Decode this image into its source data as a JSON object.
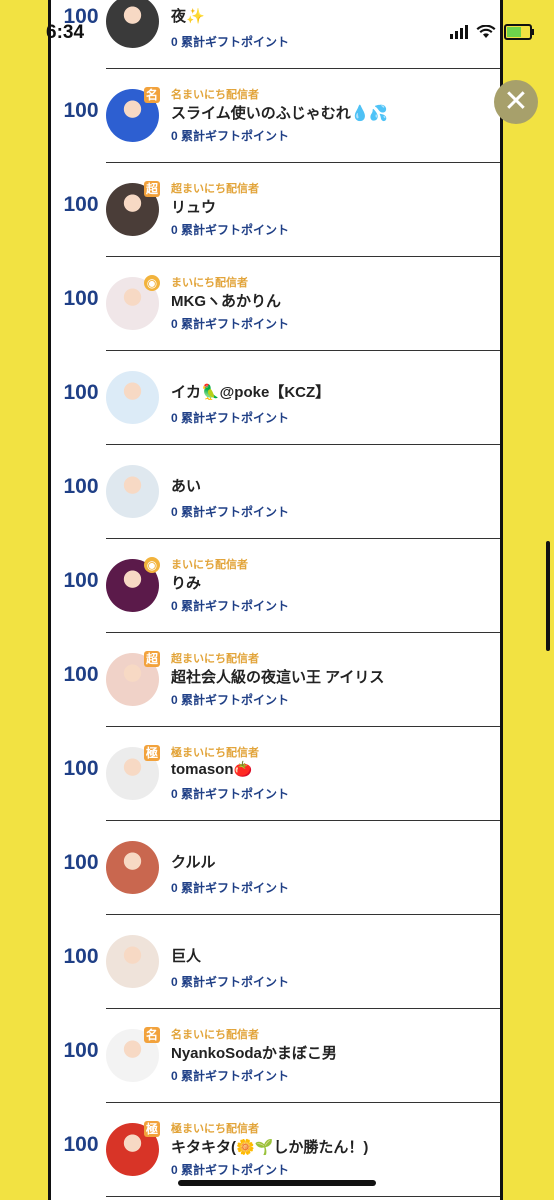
{
  "status_bar": {
    "time": "6:34"
  },
  "rows": [
    {
      "rank": "100",
      "tier": "",
      "tier_color": "#000000",
      "badge": "",
      "badge_color": "#000000",
      "name": "夜✨",
      "points": "0 累計ギフトポイント",
      "avatar": "silver-haired-portrait",
      "avatar_color": "#3a3a3a"
    },
    {
      "rank": "100",
      "tier": "名まいにち配信者",
      "tier_color": "#e2a43a",
      "badge": "名",
      "badge_color": "#f2a23c",
      "name": "スライム使いのふじゃむれ💧💦",
      "points": "0 累計ギフトポイント",
      "avatar": "blue-slime",
      "avatar_color": "#2d5fd1"
    },
    {
      "rank": "100",
      "tier": "超まいにち配信者",
      "tier_color": "#e2a43a",
      "badge": "超",
      "badge_color": "#f2a23c",
      "name": "リュウ",
      "points": "0 累計ギフトポイント",
      "avatar": "fighter",
      "avatar_color": "#4a3d38"
    },
    {
      "rank": "100",
      "tier": "まいにち配信者",
      "tier_color": "#e2a43a",
      "badge": "◉",
      "badge_color": "#f2b33c",
      "name": "MKGヽあかりん",
      "points": "0 累計ギフトポイント",
      "avatar": "anime-girl-maid",
      "avatar_color": "#f0e6e8"
    },
    {
      "rank": "100",
      "tier": "",
      "tier_color": "#000000",
      "badge": "",
      "badge_color": "#000000",
      "name": "イカ🦜@poke【KCZ】",
      "points": "0 累計ギフトポイント",
      "avatar": "chibi-boy",
      "avatar_color": "#dcebf7"
    },
    {
      "rank": "100",
      "tier": "",
      "tier_color": "#000000",
      "badge": "",
      "badge_color": "#000000",
      "name": "あい",
      "points": "0 累計ギフトポイント",
      "avatar": "beach-girl",
      "avatar_color": "#dfe8ef"
    },
    {
      "rank": "100",
      "tier": "まいにち配信者",
      "tier_color": "#e2a43a",
      "badge": "◉",
      "badge_color": "#f2b33c",
      "name": "りみ",
      "points": "0 累計ギフトポイント",
      "avatar": "woman-illustration",
      "avatar_color": "#5b1a4a"
    },
    {
      "rank": "100",
      "tier": "超まいにち配信者",
      "tier_color": "#e2a43a",
      "badge": "超",
      "badge_color": "#f2a23c",
      "name": "超社会人級の夜這い王 アイリス",
      "points": "0 累計ギフトポイント",
      "avatar": "red-haired-anime",
      "avatar_color": "#f0d2c8"
    },
    {
      "rank": "100",
      "tier": "極まいにち配信者",
      "tier_color": "#e2a43a",
      "badge": "極",
      "badge_color": "#f2a23c",
      "name": "tomason🍅",
      "points": "0 累計ギフトポイント",
      "avatar": "manga-sketch",
      "avatar_color": "#ececec"
    },
    {
      "rank": "100",
      "tier": "",
      "tier_color": "#000000",
      "badge": "",
      "badge_color": "#000000",
      "name": "クルル",
      "points": "0 累計ギフトポイント",
      "avatar": "anime-girl-red",
      "avatar_color": "#c9674f"
    },
    {
      "rank": "100",
      "tier": "",
      "tier_color": "#000000",
      "badge": "",
      "badge_color": "#000000",
      "name": "巨人",
      "points": "0 累計ギフトポイント",
      "avatar": "woman-sketch",
      "avatar_color": "#efe3da"
    },
    {
      "rank": "100",
      "tier": "名まいにち配信者",
      "tier_color": "#e2a43a",
      "badge": "名",
      "badge_color": "#f2a23c",
      "name": "NyankoSodaかまぼこ男",
      "points": "0 累計ギフトポイント",
      "avatar": "cartoon-boy",
      "avatar_color": "#f3f3f3"
    },
    {
      "rank": "100",
      "tier": "極まいにち配信者",
      "tier_color": "#e2a43a",
      "badge": "極",
      "badge_color": "#f2a23c",
      "name": "キタキタ(🌼🌱しか勝たん！)",
      "points": "0 累計ギフトポイント",
      "avatar": "blue-haired-character",
      "avatar_color": "#d83427"
    }
  ],
  "close_button": {
    "label": "✕",
    "icon": "close-icon"
  },
  "colors": {
    "background": "#f2e242",
    "rank": "#1f3f86",
    "tier": "#e2a43a"
  }
}
